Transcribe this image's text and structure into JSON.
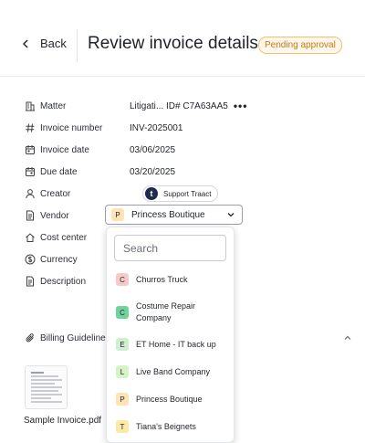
{
  "header": {
    "back_label": "Back",
    "title": "Review invoice details",
    "status_badge": "Pending approval"
  },
  "fields": {
    "matter": {
      "label": "Matter",
      "value": "Litigati... ID# C7A63AA5",
      "more": "•••"
    },
    "invoice_number": {
      "label": "Invoice number",
      "value": "INV-2025001"
    },
    "invoice_date": {
      "label": "Invoice date",
      "value": "03/06/2025"
    },
    "due_date": {
      "label": "Due date",
      "value": "03/20/2025"
    },
    "creator": {
      "label": "Creator",
      "avatar_letter": "t",
      "value": "Support Traact"
    },
    "vendor": {
      "label": "Vendor",
      "letter": "P",
      "value": "Princess Boutique"
    },
    "cost_center": {
      "label": "Cost center"
    },
    "currency": {
      "label": "Currency"
    },
    "description": {
      "label": "Description"
    }
  },
  "billing": {
    "label": "Billing Guidelines"
  },
  "attachment": {
    "file_name": "Sample Invoice.pdf"
  },
  "vendor_dropdown": {
    "search_placeholder": "Search",
    "options": [
      {
        "letter": "C",
        "name": "Churros Truck",
        "color": "#f7c9c9"
      },
      {
        "letter": "C",
        "name": "Costume Repair Company",
        "color": "#6fd49b"
      },
      {
        "letter": "E",
        "name": "ET Home - IT back up",
        "color": "#cdeecf"
      },
      {
        "letter": "L",
        "name": "Live Band Company",
        "color": "#d6f3c6"
      },
      {
        "letter": "P",
        "name": "Princess Boutique",
        "color": "#fde3b6"
      },
      {
        "letter": "T",
        "name": "Tiana's Beignets",
        "color": "#fbeaa6"
      }
    ]
  },
  "colors": {
    "badge_text": "#c2791b",
    "badge_border": "#f1c070",
    "vendor_letter_bg": "#fde3b6"
  }
}
